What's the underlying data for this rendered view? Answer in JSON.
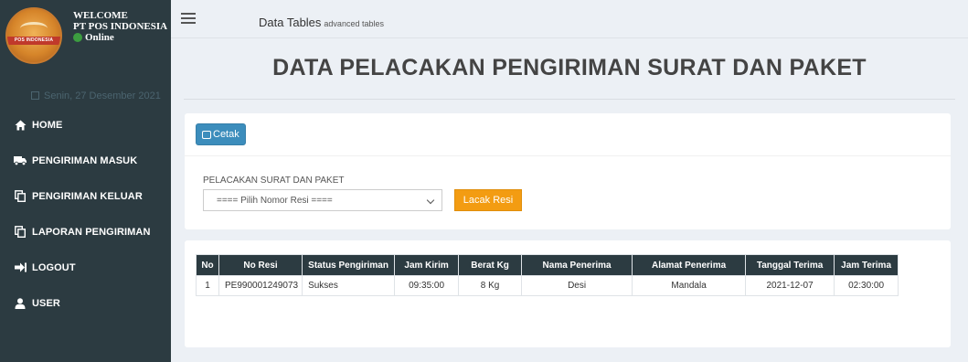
{
  "user_panel": {
    "welcome": "WELCOME",
    "org": "PT POS INDONESIA",
    "status": "Online",
    "logo_text": "POS INDONESIA"
  },
  "date": "Senin, 27 Desember 2021",
  "menu": [
    {
      "label": "HOME",
      "icon": "home-icon"
    },
    {
      "label": "PENGIRIMAN MASUK",
      "icon": "truck-icon"
    },
    {
      "label": "PENGIRIMAN KELUAR",
      "icon": "copy-icon"
    },
    {
      "label": "LAPORAN PENGIRIMAN",
      "icon": "copy-icon"
    },
    {
      "label": "LOGOUT",
      "icon": "sign-out-icon"
    },
    {
      "label": "USER",
      "icon": "user-icon"
    }
  ],
  "header": {
    "title": "Data Tables",
    "subtitle": "advanced tables"
  },
  "page_title": "DATA PELACAKAN PENGIRIMAN SURAT DAN PAKET",
  "tracking": {
    "print_label": "Cetak",
    "form_label": "PELACAKAN SURAT DAN PAKET",
    "select_value": "==== Pilih Nomor Resi ====",
    "track_button": "Lacak Resi"
  },
  "table": {
    "columns": [
      "No",
      "No Resi",
      "Status Pengiriman",
      "Jam Kirim",
      "Berat Kg",
      "Nama Penerima",
      "Alamat Penerima",
      "Tanggal Terima",
      "Jam Terima"
    ],
    "rows": [
      [
        "1",
        "PE990001249073",
        "Sukses",
        "09:35:00",
        "8 Kg",
        "Desi",
        "Mandala",
        "2021-12-07",
        "02:30:00"
      ]
    ]
  },
  "colors": {
    "sidebar_bg": "#2c3b41",
    "primary": "#3c8dbc",
    "warning": "#f39c12",
    "online": "#3c9d40"
  }
}
